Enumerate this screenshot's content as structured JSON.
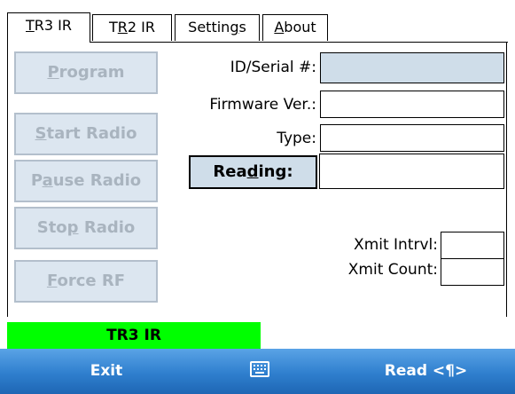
{
  "tabs": [
    {
      "prefix": "",
      "hot": "T",
      "suffix": "R3 IR",
      "active": true
    },
    {
      "prefix": "T",
      "hot": "R",
      "suffix": "2 IR",
      "active": false
    },
    {
      "prefix": "Settin",
      "hot": "g",
      "suffix": "s",
      "active": false
    },
    {
      "prefix": "",
      "hot": "A",
      "suffix": "bout",
      "active": false
    }
  ],
  "buttons": {
    "program": {
      "prefix": "",
      "hot": "P",
      "suffix": "rogram"
    },
    "start_radio": {
      "prefix": "",
      "hot": "S",
      "suffix": "tart Radio"
    },
    "pause_radio": {
      "prefix": "P",
      "hot": "a",
      "suffix": "use Radio"
    },
    "stop_radio": {
      "prefix": "Sto",
      "hot": "p",
      "suffix": " Radio"
    },
    "force_rf": {
      "prefix": "",
      "hot": "F",
      "suffix": "orce RF"
    }
  },
  "fields": {
    "id_serial_label": "ID/Serial #:",
    "id_serial_value": "",
    "firmware_label": "Firmware Ver.:",
    "firmware_value": "",
    "type_label": "Type:",
    "type_value": "",
    "reading_button": {
      "prefix": "Rea",
      "hot": "d",
      "suffix": "ing:"
    },
    "reading_value": "",
    "xmit_intrvl_label": "Xmit Intrvl:",
    "xmit_intrvl_value": "",
    "xmit_count_label": "Xmit Count:",
    "xmit_count_value": ""
  },
  "status": {
    "text": "TR3 IR",
    "color": "#00ff00"
  },
  "softkeys": {
    "left": "Exit",
    "right": "Read <¶>",
    "center_icon": "keyboard-icon"
  },
  "colors": {
    "softbar_top": "#5aa3e6",
    "softbar_bottom": "#1e66b4",
    "field_blue": "#cfdde9",
    "disabled_text": "#a9b4bf"
  }
}
